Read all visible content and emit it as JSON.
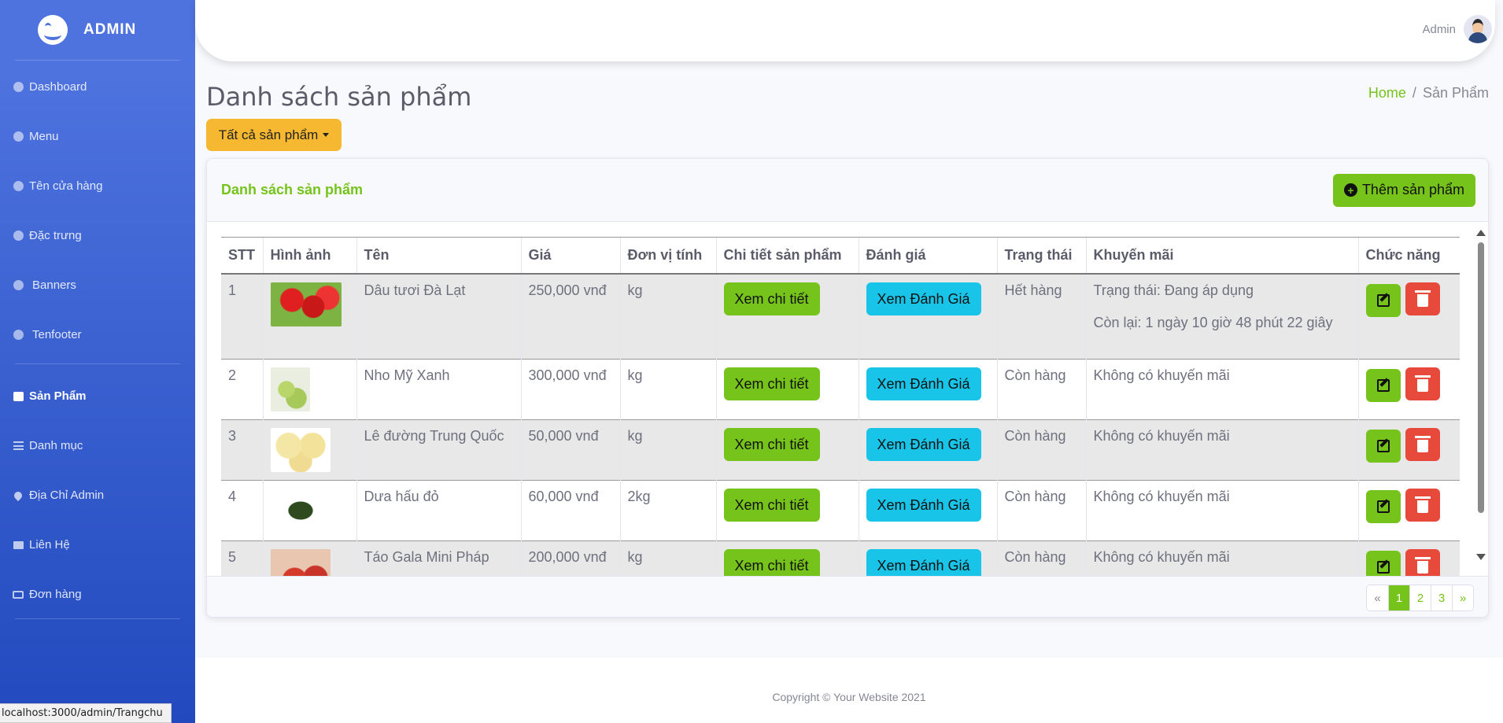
{
  "sidebar": {
    "brand": "ADMIN",
    "items": [
      {
        "label": "Dashboard",
        "icon": "palette-icon"
      },
      {
        "label": "Menu",
        "icon": "palette-icon"
      },
      {
        "label": "Tên cửa hàng",
        "icon": "palette-icon"
      },
      {
        "label": "Đặc trưng",
        "icon": "palette-icon"
      },
      {
        "label": "Banners",
        "icon": "palette-icon"
      },
      {
        "label": "Tenfooter",
        "icon": "palette-icon"
      },
      {
        "label": "Sản Phẩm",
        "icon": "calendar-icon",
        "active": true
      },
      {
        "label": "Danh mục",
        "icon": "list-icon"
      },
      {
        "label": "Địa Chỉ Admin",
        "icon": "map-pin-icon"
      },
      {
        "label": "Liên Hệ",
        "icon": "envelope-icon"
      },
      {
        "label": "Đơn hàng",
        "icon": "id-card-icon"
      }
    ]
  },
  "status_url": "localhost:3000/admin/Trangchu",
  "topbar": {
    "user_name": "Admin"
  },
  "page": {
    "title": "Danh sách sản phẩm",
    "breadcrumb_home": "Home",
    "breadcrumb_sep": "/",
    "breadcrumb_current": "Sản Phẩm",
    "filter_label": "Tất cả sản phẩm"
  },
  "card": {
    "title": "Danh sách sản phẩm",
    "add_label": "Thêm sản phẩm"
  },
  "table": {
    "headers": [
      "STT",
      "Hình ảnh",
      "Tên",
      "Giá",
      "Đơn vị tính",
      "Chi tiết sản phẩm",
      "Đánh giá",
      "Trạng thái",
      "Khuyến mãi",
      "Chức năng"
    ],
    "detail_label": "Xem chi tiết",
    "review_label": "Xem Đánh Giá",
    "rows": [
      {
        "stt": "1",
        "name": "Dâu tươi Đà Lạt",
        "price": "250,000 vnđ",
        "unit": "kg",
        "status": "Hết hàng",
        "promo": "Trạng thái: Đang áp dụng",
        "promo2": "Còn lại: 1 ngày 10 giờ 48 phút 22 giây"
      },
      {
        "stt": "2",
        "name": "Nho Mỹ Xanh",
        "price": "300,000 vnđ",
        "unit": "kg",
        "status": "Còn hàng",
        "promo": "Không có khuyến mãi"
      },
      {
        "stt": "3",
        "name": "Lê đường Trung Quốc",
        "price": "50,000 vnđ",
        "unit": "kg",
        "status": "Còn hàng",
        "promo": "Không có khuyến mãi"
      },
      {
        "stt": "4",
        "name": "Dưa hấu đỏ",
        "price": "60,000 vnđ",
        "unit": "2kg",
        "status": "Còn hàng",
        "promo": "Không có khuyến mãi"
      },
      {
        "stt": "5",
        "name": "Táo Gala Mini Pháp",
        "price": "200,000 vnđ",
        "unit": "kg",
        "status": "Còn hàng",
        "promo": "Không có khuyến mãi"
      }
    ]
  },
  "pagination": {
    "prev": "«",
    "pages": [
      "1",
      "2",
      "3"
    ],
    "next": "»",
    "active": "1"
  },
  "footer": {
    "copyright": "Copyright © Your Website 2021"
  },
  "colors": {
    "primary": "#4e73df",
    "accent_green": "#76c31b",
    "info": "#18c5e8",
    "danger": "#e74a3b",
    "warning": "#f6b830"
  }
}
